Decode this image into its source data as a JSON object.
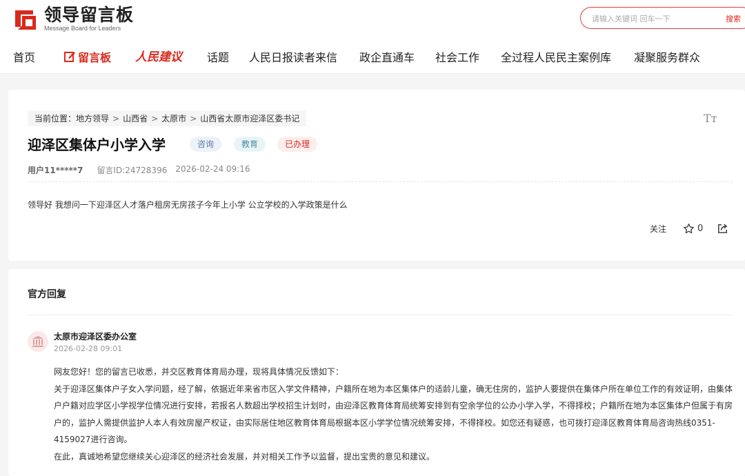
{
  "header": {
    "logo_cn": "领导留言板",
    "logo_en": "Message Board for Leaders",
    "search_placeholder": "请输入关键词 回车一下",
    "search_button": "搜索"
  },
  "nav": {
    "items": [
      "首页",
      "留言板",
      "人民建议",
      "话题",
      "人民日报读者来信",
      "政企直通车",
      "社会工作",
      "全过程人民民主案例库",
      "凝聚服务群众"
    ]
  },
  "message": {
    "breadcrumb_label": "当前位置：",
    "breadcrumb": [
      "地方领导",
      "山西省",
      "太原市",
      "山西省太原市迎泽区委书记"
    ],
    "font_toggle": "Tт",
    "title": "迎泽区集体户小学入学",
    "tags": [
      "咨询",
      "教育",
      "已办理"
    ],
    "user": "用户11*****7",
    "message_id": "留言ID:24728396",
    "datetime": "2026-02-24 09:16",
    "content": "领导好 我想问一下迎泽区人才落户租房无房孩子今年上小学 公立学校的入学政策是什么",
    "follow_label": "关注",
    "star_count": "0"
  },
  "reply": {
    "section_title": "官方回复",
    "office": "太原市迎泽区委办公室",
    "datetime": "2026-02-28 09:01",
    "paragraphs": [
      "网友您好！您的留言已收悉，并交区教育体育局办理，现将具体情况反馈如下：",
      "关于迎泽区集体户子女入学问题，经了解，依据近年来省市区入学文件精神，户籍所在地为本区集体户的适龄儿童，确无住房的，监护人要提供在集体户所在单位工作的有效证明，由集体户户籍对应学区小学视学位情况进行安排，若报名人数超出学校招生计划时，由迎泽区教育体育局统筹安排到有空余学位的公办小学入学，不得择校；户籍所在地为本区集体户但属于有房户的，监护人需提供监护人本人有效房屋产权证，由实际居住地区教育体育局根据本区小学学位情况统筹安排，不得择校。如您还有疑惑，也可拨打迎泽区教育体育局咨询热线0351-4159027进行咨询。",
      "在此，真诚地希望您继续关心迎泽区的经济社会发展，并对相关工作予以监督，提出宝贵的意见和建议。"
    ]
  },
  "colors": {
    "brand_red": "#d9291c"
  }
}
